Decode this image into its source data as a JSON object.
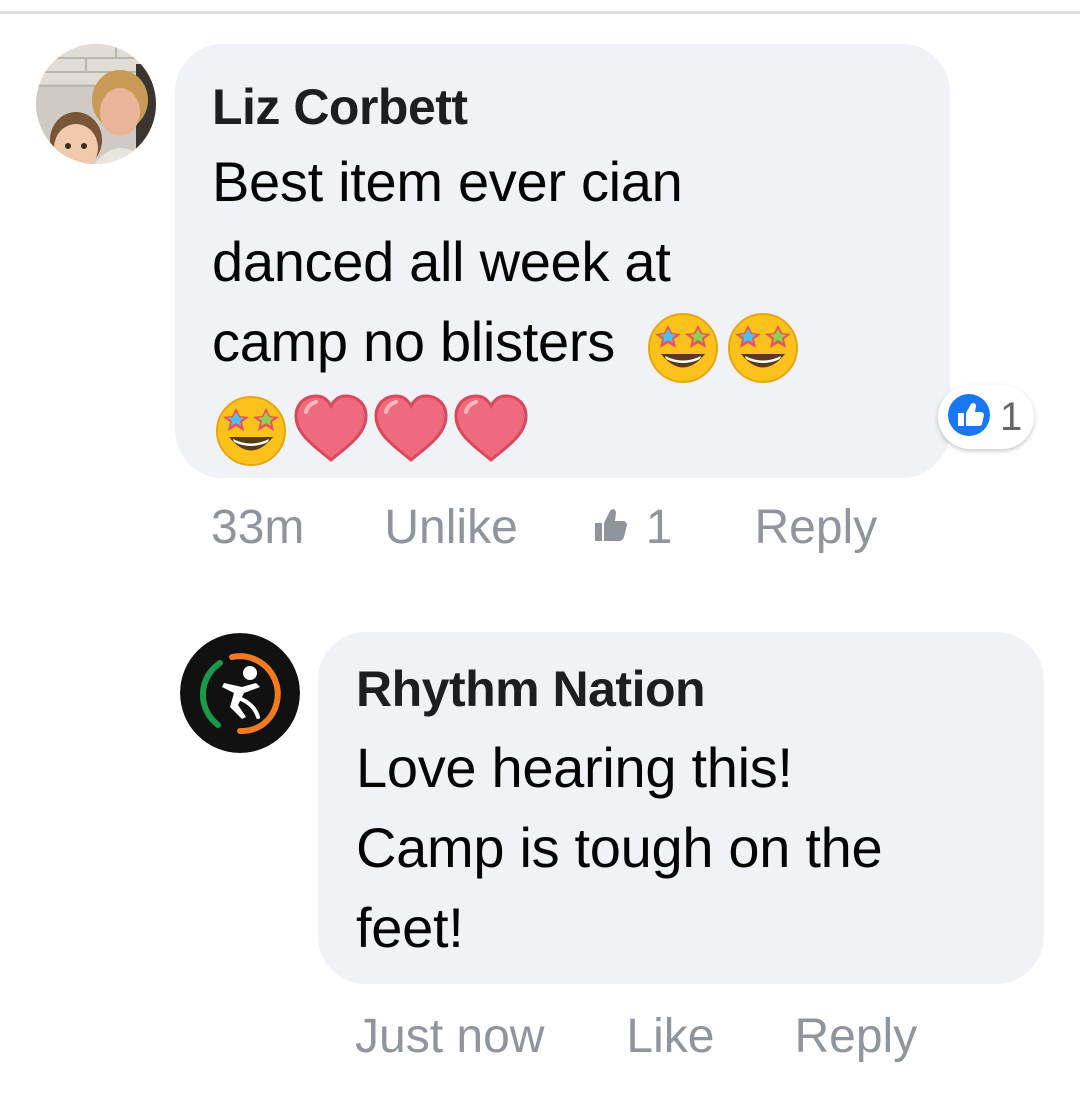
{
  "comments": [
    {
      "author": "Liz Corbett",
      "text_lines": [
        "Best item ever cian",
        "danced all week at",
        "camp no blisters"
      ],
      "emoji_row_1": [
        "star-struck-emoji",
        "star-struck-emoji"
      ],
      "emoji_row_2": [
        "star-struck-emoji",
        "heart-emoji",
        "heart-emoji",
        "heart-emoji"
      ],
      "reaction_icon": "like-icon",
      "reaction_count": "1",
      "actions": {
        "time": "33m",
        "like_label": "Unlike",
        "like_count": "1",
        "reply_label": "Reply"
      }
    },
    {
      "author": "Rhythm Nation",
      "text_lines": [
        "Love hearing this!",
        "Camp is tough on the",
        "feet!"
      ],
      "actions": {
        "time": "Just now",
        "like_label": "Like",
        "reply_label": "Reply"
      }
    }
  ],
  "colors": {
    "bubble": "#f0f2f5",
    "like_blue": "#1877f2",
    "meta_gray": "#90949c",
    "logo_orange": "#f47a20",
    "logo_green": "#1a9a48"
  }
}
